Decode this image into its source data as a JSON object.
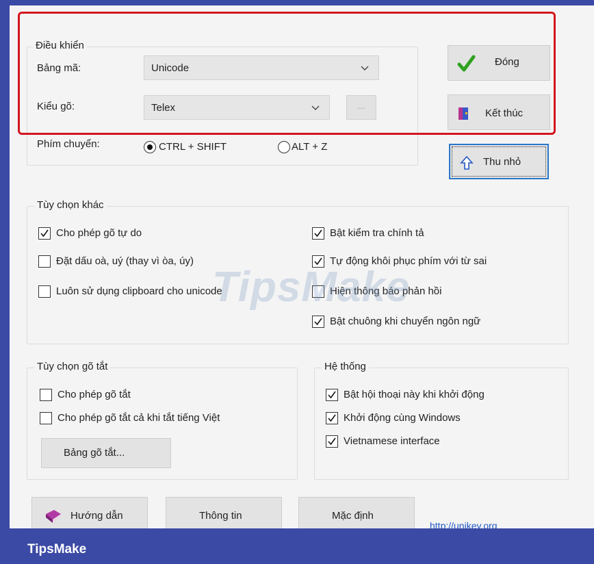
{
  "dieu_khien": {
    "legend": "Điều khiển",
    "bang_ma_label": "Bảng mã:",
    "bang_ma_value": "Unicode",
    "kieu_go_label": "Kiểu gõ:",
    "kieu_go_value": "Telex",
    "extra_button": "...",
    "phim_chuyen_label": "Phím chuyển:",
    "radio_ctrl_shift": {
      "label": "CTRL + SHIFT",
      "selected": true
    },
    "radio_alt_z": {
      "label": "ALT + Z",
      "selected": false
    }
  },
  "buttons": {
    "dong": "Đóng",
    "ket_thuc": "Kết thúc",
    "thu_nho": "Thu nhỏ",
    "huong_dan": "Hướng dẫn",
    "thong_tin": "Thông tin",
    "mac_dinh": "Mặc định",
    "bang_go_tat": "Bảng gõ tắt..."
  },
  "tuy_chon_khac": {
    "legend": "Tùy chọn khác",
    "options": [
      {
        "label": "Cho phép gõ tự do",
        "checked": true
      },
      {
        "label": "Đặt dấu oà, uý (thay vì òa, úy)",
        "checked": false
      },
      {
        "label": "Luôn sử dụng clipboard cho unicode",
        "checked": false
      },
      {
        "label": "Bật kiểm tra chính tả",
        "checked": true
      },
      {
        "label": "Tự động khôi phục phím với từ sai",
        "checked": true
      },
      {
        "label": "Hiện thông báo phản hồi",
        "checked": false
      },
      {
        "label": "Bật chuông khi chuyển ngôn ngữ",
        "checked": true
      }
    ]
  },
  "tuy_chon_go_tat": {
    "legend": "Tùy chọn gõ tắt",
    "options": [
      {
        "label": "Cho phép gõ tắt",
        "checked": false
      },
      {
        "label": "Cho phép gõ tắt cả khi tắt tiếng Việt",
        "checked": false
      }
    ]
  },
  "he_thong": {
    "legend": "Hệ thống",
    "options": [
      {
        "label": "Bật hội thoại này khi khởi động",
        "checked": true
      },
      {
        "label": "Khởi động cùng Windows",
        "checked": true
      },
      {
        "label": "Vietnamese interface",
        "checked": true
      }
    ]
  },
  "link": "http://unikey.org",
  "watermark": "TipsMake",
  "footer_brand": "TipsMake",
  "colors": {
    "highlight": "#d3161f",
    "footer": "#3b4aa5",
    "link": "#2457c5",
    "check_green": "#2fa11e"
  }
}
